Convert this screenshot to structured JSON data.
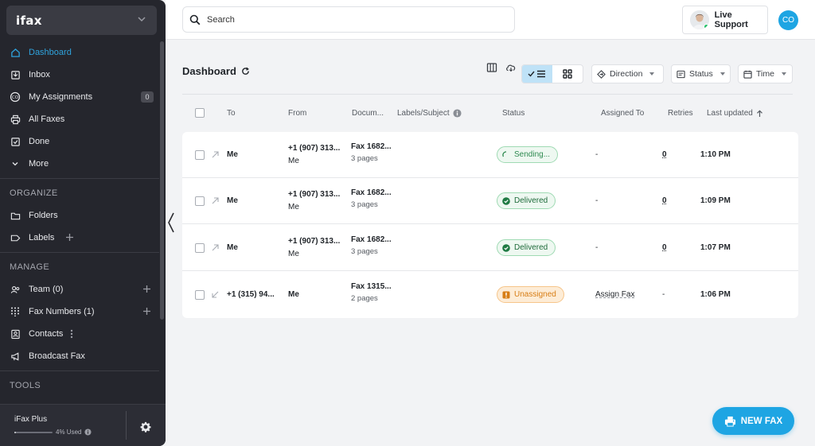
{
  "app": {
    "brand": "ifax"
  },
  "sidebar": {
    "nav": [
      {
        "label": "Dashboard",
        "icon": "home-icon",
        "active": true
      },
      {
        "label": "Inbox",
        "icon": "inbox-icon"
      },
      {
        "label": "My Assignments",
        "icon": "assignments-icon",
        "badge": "0"
      },
      {
        "label": "All Faxes",
        "icon": "printer-icon"
      },
      {
        "label": "Done",
        "icon": "done-icon"
      },
      {
        "label": "More",
        "icon": "chevron-down-icon"
      }
    ],
    "organize_title": "ORGANIZE",
    "organize": [
      {
        "label": "Folders",
        "icon": "folder-icon"
      },
      {
        "label": "Labels",
        "icon": "label-icon"
      }
    ],
    "manage_title": "MANAGE",
    "manage": [
      {
        "label": "Team (0)",
        "icon": "team-icon"
      },
      {
        "label": "Fax Numbers (1)",
        "icon": "dialpad-icon"
      },
      {
        "label": "Contacts",
        "icon": "contacts-icon"
      },
      {
        "label": "Broadcast Fax",
        "icon": "megaphone-icon"
      }
    ],
    "tools_title": "TOOLS",
    "plan": {
      "name": "iFax Plus",
      "used_label": "4% Used",
      "used_fraction": 0.04
    }
  },
  "topbar": {
    "search_placeholder": "Search",
    "live_support": "Live Support",
    "user_initials": "CO"
  },
  "main": {
    "title": "Dashboard",
    "filters": {
      "direction": "Direction",
      "status": "Status",
      "time": "Time"
    },
    "columns": [
      "To",
      "From",
      "Docum...",
      "Labels/Subject",
      "Status",
      "Assigned To",
      "Retries",
      "Last updated"
    ],
    "rows": [
      {
        "direction": "outgoing",
        "to": "Me",
        "from": "+1 (907) 313...",
        "from_sub": "Me",
        "doc": "Fax 1682...",
        "pages": "3 pages",
        "status": "Sending...",
        "status_type": "sending",
        "assigned": "-",
        "retries": "0",
        "updated": "1:10 PM"
      },
      {
        "direction": "outgoing",
        "to": "Me",
        "from": "+1 (907) 313...",
        "from_sub": "Me",
        "doc": "Fax 1682...",
        "pages": "3 pages",
        "status": "Delivered",
        "status_type": "delivered",
        "assigned": "-",
        "retries": "0",
        "updated": "1:09 PM"
      },
      {
        "direction": "outgoing",
        "to": "Me",
        "from": "+1 (907) 313...",
        "from_sub": "Me",
        "doc": "Fax 1682...",
        "pages": "3 pages",
        "status": "Delivered",
        "status_type": "delivered",
        "assigned": "-",
        "retries": "0",
        "updated": "1:07 PM"
      },
      {
        "direction": "incoming",
        "to": "+1 (315) 94...",
        "from": "Me",
        "from_sub": "",
        "doc": "Fax 1315...",
        "pages": "2 pages",
        "status": "Unassigned",
        "status_type": "unassigned",
        "assigned": "Assign Fax",
        "retries": "-",
        "updated": "1:06 PM"
      }
    ],
    "new_fax": "NEW FAX"
  },
  "colors": {
    "accent": "#1ea5e3",
    "sidebar_bg": "#25262d",
    "active_nav": "#2fa3dd",
    "delivered": "#1f6b3b",
    "unassigned": "#d77d15"
  }
}
